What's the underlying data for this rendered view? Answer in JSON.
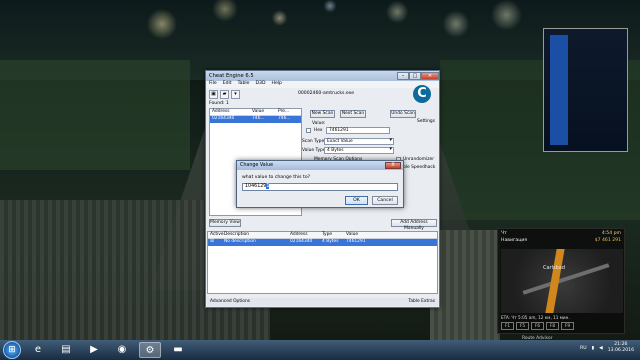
{
  "cheat_engine": {
    "title": "Cheat Engine 6.5",
    "process": "00002460-amtrucks.exe",
    "menu": [
      "File",
      "Edit",
      "Table",
      "D3D",
      "Help"
    ],
    "found_label": "Found: 1",
    "results_columns": [
      "Address",
      "Value",
      "Pre..."
    ],
    "results_row": {
      "address": "02164340",
      "value": "746...",
      "prev": "746..."
    },
    "new_scan": "New Scan",
    "next_scan": "Next Scan",
    "undo_scan": "Undo Scan",
    "settings": "Settings",
    "value_label": "Value:",
    "hex_label": "Hex",
    "value_input": "7461291",
    "scan_type_label": "Scan Type",
    "scan_type_value": "Exact Value",
    "value_type_label": "Value Type",
    "value_type_value": "4 Bytes",
    "memory_scan_options": "Memory Scan Options",
    "unrandomizer": "Unrandomizer",
    "speedhack": "ble Speedhack",
    "memory_view": "Memory View",
    "add_address_manually": "Add Address Manually",
    "addr_columns": [
      "Active",
      "Description",
      "Address",
      "Type",
      "Value"
    ],
    "addr_row": {
      "description": "No description",
      "address": "02164340",
      "type": "4 Bytes",
      "value": "7461291"
    },
    "advanced_options": "Advanced Options",
    "table_extras": "Table Extras"
  },
  "dialog": {
    "title": "Change Value",
    "close": "X",
    "prompt": "what value to change this to?",
    "input": "1046129",
    "input_selected": "1",
    "ok": "OK",
    "cancel": "Cancel"
  },
  "hud": {
    "day": "Чт",
    "time": "4:54 pm",
    "nav": "Навигация",
    "money": "$7 461 291",
    "city": "Carlsbad",
    "eta": "ETA: Чт 5:05 am, 12 км, 11 мин.",
    "fkeys": [
      "F1",
      "F5",
      "F6",
      "F8",
      "F9"
    ],
    "route_advisor": "Route Advisor"
  },
  "taskbar": {
    "start_glyph": "⊞",
    "apps": [
      {
        "name": "ie-icon",
        "glyph": "e"
      },
      {
        "name": "explorer-icon",
        "glyph": "▤"
      },
      {
        "name": "media-player-icon",
        "glyph": "▶"
      },
      {
        "name": "chrome-icon",
        "glyph": "◉"
      },
      {
        "name": "cheat-engine-icon",
        "glyph": "⚙"
      },
      {
        "name": "truck-game-icon",
        "glyph": "▬"
      }
    ],
    "lang": "RU",
    "time": "21:26",
    "date": "13.06.2016"
  }
}
